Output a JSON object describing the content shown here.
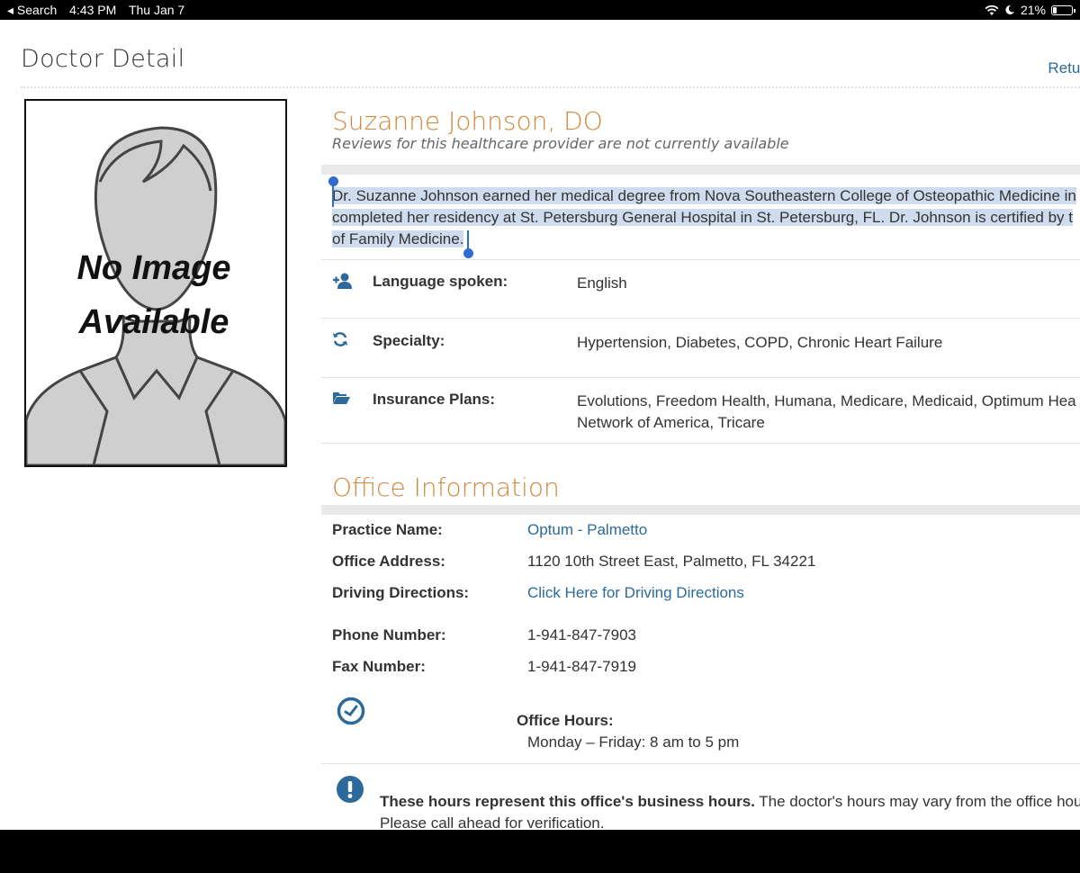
{
  "status_bar": {
    "back_label": "◂ Search",
    "time": "4:43 PM",
    "date": "Thu Jan 7",
    "battery_text": "21%",
    "battery_level": 0.21
  },
  "header": {
    "title": "Doctor Detail",
    "return_label": "Retur"
  },
  "photo": {
    "caption_line1": "No Image",
    "caption_line2": "Available"
  },
  "doctor": {
    "name": "Suzanne Johnson, DO",
    "reviews_note": "Reviews for this healthcare provider are not currently available",
    "bio_lines": [
      "Dr. Suzanne Johnson earned her medical degree from Nova Southeastern College of Osteopathic Medicine in",
      "completed her residency at St. Petersburg General Hospital in St. Petersburg, FL.   Dr. Johnson is certified by t",
      "of Family Medicine."
    ]
  },
  "details": [
    {
      "icon": "add-user-icon",
      "label": "Language spoken:",
      "value": "English"
    },
    {
      "icon": "refresh-icon",
      "label": "Specialty:",
      "value": "Hypertension, Diabetes, COPD, Chronic Heart Failure"
    },
    {
      "icon": "folder-open-icon",
      "label": "Insurance Plans:",
      "value_line1": "Evolutions, Freedom Health, Humana, Medicare, Medicaid, Optimum Hea",
      "value_line2": "Network of America, Tricare"
    }
  ],
  "office": {
    "title": "Office Information",
    "practice_label": "Practice Name:",
    "practice_value": "Optum - Palmetto",
    "address_label": "Office Address:",
    "address_value": "1120 10th Street East, Palmetto, FL 34221",
    "directions_label": "Driving Directions:",
    "directions_value": "Click Here for Driving Directions",
    "phone_label": "Phone Number:",
    "phone_value": "1-941-847-7903",
    "fax_label": "Fax Number:",
    "fax_value": "1-941-847-7919",
    "hours_label": "Office Hours:",
    "hours_value": "Monday – Friday: 8 am to 5 pm",
    "notice_bold": "These hours represent this office's business hours.",
    "notice_rest": " The doctor's hours may vary from the office hou",
    "notice_line2": "Please call ahead for verification."
  },
  "colors": {
    "accent_orange": "#d2873a",
    "link_blue": "#2b6a9b",
    "selection": "#cfdcee"
  }
}
